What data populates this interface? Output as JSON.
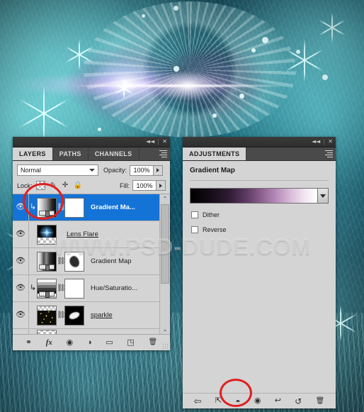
{
  "document": {
    "watermark": "WWW.PSD-DUDE.COM",
    "artwork_description": "winter wreath with snowflakes and lens flare, cyan toned"
  },
  "layers_panel": {
    "titlebar": {
      "collapse_icon": "collapse-icon",
      "collapse_glyph": "◄◄",
      "close_glyph": "✕"
    },
    "tabs": [
      {
        "label": "LAYERS",
        "active": true
      },
      {
        "label": "PATHS",
        "active": false
      },
      {
        "label": "CHANNELS",
        "active": false
      }
    ],
    "blend_mode": "Normal",
    "opacity_label": "Opacity:",
    "opacity_value": "100%",
    "lock_label": "Lock:",
    "lock_icons": [
      "lock-transparent-pixels",
      "lock-image-pixels",
      "lock-position",
      "lock-all"
    ],
    "fill_label": "Fill:",
    "fill_value": "100%",
    "layers": [
      {
        "name": "Gradient Ma...",
        "selected": true,
        "clipped": true,
        "has_mask": true,
        "visible": true,
        "thumb": "gradient"
      },
      {
        "name": "Lens Flare",
        "selected": false,
        "clipped": false,
        "has_mask": false,
        "visible": true,
        "thumb": "flare",
        "underline": true
      },
      {
        "name": "Gradient Map",
        "selected": false,
        "clipped": false,
        "has_mask": true,
        "visible": true,
        "thumb": "gradient2"
      },
      {
        "name": "Hue/Saturatio...",
        "selected": false,
        "clipped": true,
        "has_mask": true,
        "visible": true,
        "thumb": "gradient3"
      },
      {
        "name": "sparkle",
        "selected": false,
        "clipped": false,
        "has_mask": true,
        "visible": true,
        "thumb": "sparkle",
        "underline": true
      }
    ],
    "scrollbar": {
      "up_glyph": "⌃",
      "down_glyph": "⌄"
    },
    "footer_buttons": [
      {
        "name": "link-layers-button",
        "glyph": "⚭"
      },
      {
        "name": "layer-style-fx-button",
        "glyph": "fx"
      },
      {
        "name": "add-layer-mask-button",
        "glyph": "◉"
      },
      {
        "name": "new-adjustment-layer-button",
        "glyph": "◑"
      },
      {
        "name": "new-group-button",
        "glyph": "▭"
      },
      {
        "name": "new-layer-button",
        "glyph": "◳"
      },
      {
        "name": "delete-layer-button",
        "glyph": "🗑"
      }
    ]
  },
  "adjustments_panel": {
    "titlebar": {
      "collapse_glyph": "◄◄",
      "close_glyph": "✕"
    },
    "tab_label": "ADJUSTMENTS",
    "title": "Gradient Map",
    "gradient": {
      "stops": [
        "#000000",
        "#2e1b33",
        "#8c6090",
        "#dcc0dc",
        "#ffffff"
      ],
      "caret_glyph": "▾"
    },
    "checkboxes": [
      {
        "label": "Dither",
        "checked": false
      },
      {
        "label": "Reverse",
        "checked": false
      }
    ],
    "footer_buttons": [
      {
        "name": "return-to-adjustment-list-button",
        "glyph": "⇦"
      },
      {
        "name": "clip-to-layer-button",
        "glyph": "⇱"
      },
      {
        "name": "toggle-layer-visibility-button",
        "glyph": "◓"
      },
      {
        "name": "preview-eye-button",
        "glyph": "◉"
      },
      {
        "name": "view-previous-state-button",
        "glyph": "↩"
      },
      {
        "name": "reset-adjustment-button",
        "glyph": "↺"
      },
      {
        "name": "delete-adjustment-button",
        "glyph": "🗑"
      }
    ]
  },
  "annotations": {
    "circle_color": "#e01f1f",
    "highlights": [
      "gradient-map-layer-thumbnail",
      "toggle-layer-visibility-button"
    ]
  }
}
